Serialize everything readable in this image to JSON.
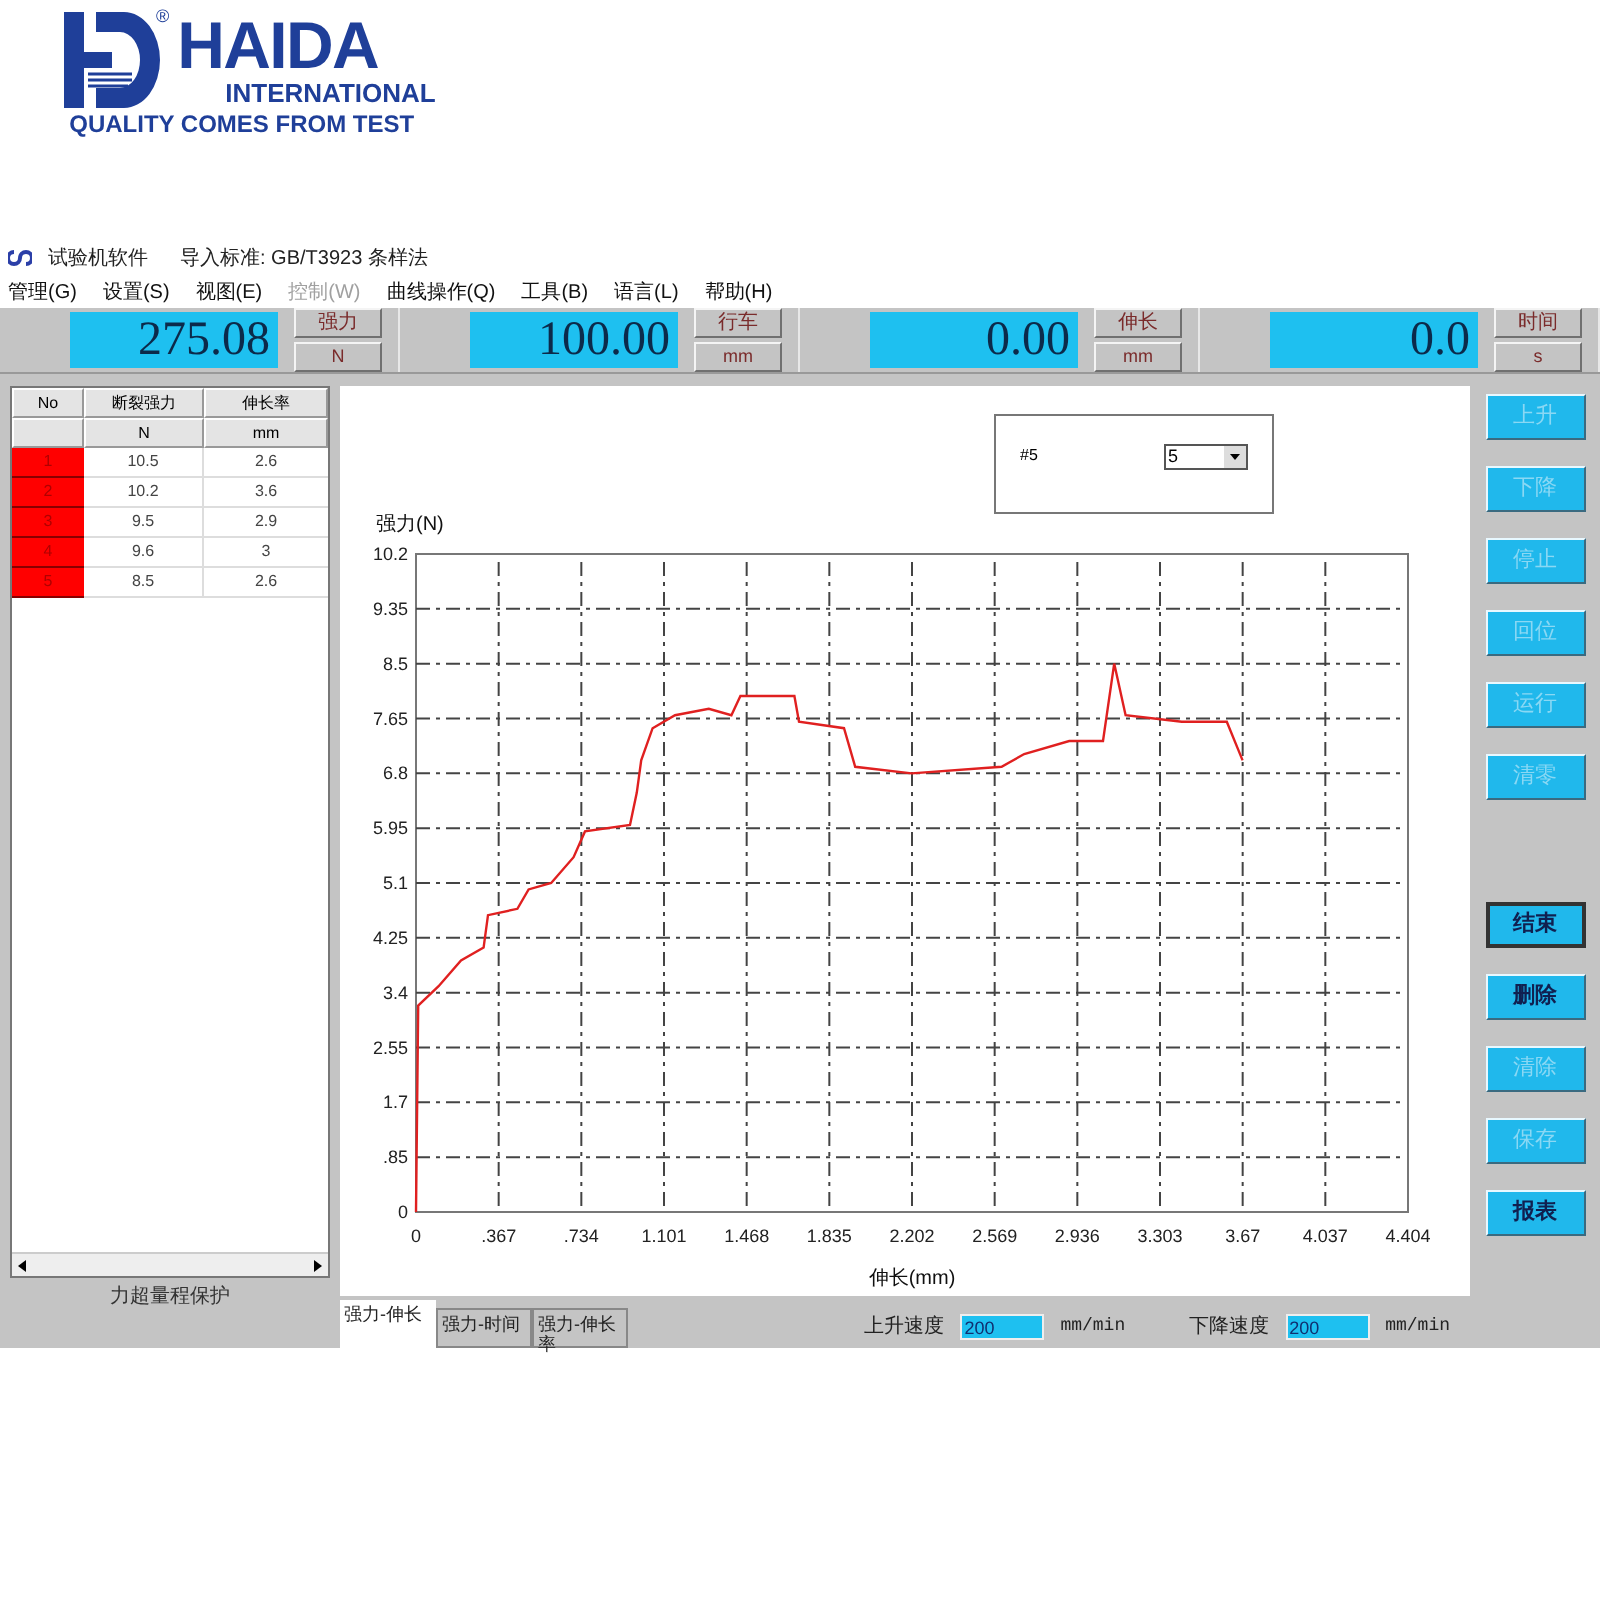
{
  "logo": {
    "brand": "HAIDA",
    "registered": "®",
    "subtitle": "INTERNATIONAL",
    "slogan": "QUALITY COMES FROM TEST"
  },
  "window": {
    "app_name": "试验机软件",
    "standard": "导入标准: GB/T3923 条样法"
  },
  "menu": [
    {
      "label": "管理(G)",
      "disabled": false
    },
    {
      "label": "设置(S)",
      "disabled": false
    },
    {
      "label": "视图(E)",
      "disabled": false
    },
    {
      "label": "控制(W)",
      "disabled": true
    },
    {
      "label": "曲线操作(Q)",
      "disabled": false
    },
    {
      "label": "工具(B)",
      "disabled": false
    },
    {
      "label": "语言(L)",
      "disabled": false
    },
    {
      "label": "帮助(H)",
      "disabled": false
    }
  ],
  "readouts": [
    {
      "value": "275.08",
      "label": "强力",
      "unit": "N"
    },
    {
      "value": "100.00",
      "label": "行车",
      "unit": "mm"
    },
    {
      "value": "0.00",
      "label": "伸长",
      "unit": "mm"
    },
    {
      "value": "0.0",
      "label": "时间",
      "unit": "s"
    }
  ],
  "table": {
    "columns": [
      "No",
      "断裂强力",
      "伸长率"
    ],
    "units": [
      "N",
      "mm"
    ],
    "rows": [
      {
        "no": "1",
        "force": "10.5",
        "elongation": "2.6",
        "color": "#ff0000"
      },
      {
        "no": "2",
        "force": "10.2",
        "elongation": "3.6",
        "color": "#ff0000"
      },
      {
        "no": "3",
        "force": "9.5",
        "elongation": "2.9",
        "color": "#ff0000"
      },
      {
        "no": "4",
        "force": "9.6",
        "elongation": "3",
        "color": "#ff0000"
      },
      {
        "no": "5",
        "force": "8.5",
        "elongation": "2.6",
        "color": "#ff0000"
      }
    ],
    "status": "力超量程保护"
  },
  "sample_picker": {
    "value": "5"
  },
  "chart_data": {
    "type": "line",
    "grid": true,
    "ylabel": "强力(N)",
    "xlabel": "伸长(mm)",
    "xlim": [
      0,
      4.404
    ],
    "ylim": [
      0,
      10.2
    ],
    "xticks": [
      0,
      {
        "value": 0.367,
        "label": ".367"
      },
      {
        "value": 0.734,
        "label": ".734"
      },
      1.101,
      1.468,
      1.835,
      2.202,
      2.569,
      2.936,
      3.303,
      3.67,
      4.037,
      4.404
    ],
    "yticks": [
      0,
      {
        "value": 0.85,
        "label": ".85"
      },
      1.7,
      2.55,
      3.4,
      4.25,
      5.1,
      5.95,
      6.8,
      7.65,
      8.5,
      9.35,
      10.2
    ],
    "x": [
      0,
      0.01,
      0.1,
      0.2,
      0.3,
      0.32,
      0.45,
      0.5,
      0.6,
      0.7,
      0.75,
      0.95,
      0.98,
      1.0,
      1.05,
      1.15,
      1.3,
      1.4,
      1.44,
      1.68,
      1.7,
      1.9,
      1.95,
      2.2,
      2.6,
      2.7,
      2.9,
      3.05,
      3.1,
      3.15,
      3.4,
      3.6,
      3.67
    ],
    "series": [
      {
        "name": "#5",
        "color": "#e02020",
        "values": [
          0,
          3.2,
          3.5,
          3.9,
          4.1,
          4.6,
          4.7,
          5.0,
          5.1,
          5.5,
          5.9,
          6.0,
          6.5,
          7.0,
          7.5,
          7.7,
          7.8,
          7.7,
          8.0,
          8.0,
          7.6,
          7.5,
          6.9,
          6.8,
          6.9,
          7.1,
          7.3,
          7.3,
          8.5,
          7.7,
          7.6,
          7.6,
          7.0
        ]
      }
    ]
  },
  "chart_tabs": [
    {
      "label": "强力-伸长",
      "selected": true
    },
    {
      "label": "强力-时间",
      "selected": false
    },
    {
      "label": "强力-伸长率",
      "selected": false
    }
  ],
  "speeds": [
    {
      "label": "上升速度",
      "value": "200",
      "unit": "mm/min"
    },
    {
      "label": "下降速度",
      "value": "200",
      "unit": "mm/min"
    }
  ],
  "buttons": [
    {
      "label": "上升",
      "disabled": true,
      "focused": false
    },
    {
      "label": "下降",
      "disabled": true,
      "focused": false
    },
    {
      "label": "停止",
      "disabled": true,
      "focused": false
    },
    {
      "label": "回位",
      "disabled": true,
      "focused": false
    },
    {
      "label": "运行",
      "disabled": true,
      "focused": false
    },
    {
      "label": "清零",
      "disabled": true,
      "focused": false
    },
    {
      "label": "结束",
      "disabled": false,
      "focused": true
    },
    {
      "label": "删除",
      "disabled": false,
      "focused": false
    },
    {
      "label": "清除",
      "disabled": true,
      "focused": false
    },
    {
      "label": "保存",
      "disabled": true,
      "focused": false
    },
    {
      "label": "报表",
      "disabled": false,
      "focused": false
    }
  ]
}
